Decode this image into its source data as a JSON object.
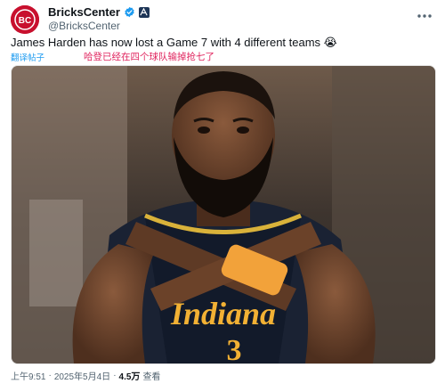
{
  "account": {
    "display_name": "BricksCenter",
    "handle": "@BricksCenter",
    "avatar_text": "BC"
  },
  "tweet": {
    "text": "James Harden has now lost a Game 7 with 4 different teams",
    "emoji": "😭",
    "translate_label": "翻译帖子",
    "translation": "哈登已经在四个球队输掉抢七了"
  },
  "photo": {
    "jersey_text": "Indiana",
    "number_text": "3"
  },
  "meta": {
    "time": "上午9:51",
    "separator": "·",
    "date": "2025年5月4日",
    "views_count": "4.5万",
    "views_label": "查看"
  },
  "colors": {
    "brand": "#c8102e",
    "verified": "#1d9bf0",
    "link": "#1d9bf0",
    "translation": "#e0245e"
  },
  "icons": {
    "verified": "verified-badge-icon",
    "org": "affiliate-badge-icon",
    "more": "more-icon"
  }
}
